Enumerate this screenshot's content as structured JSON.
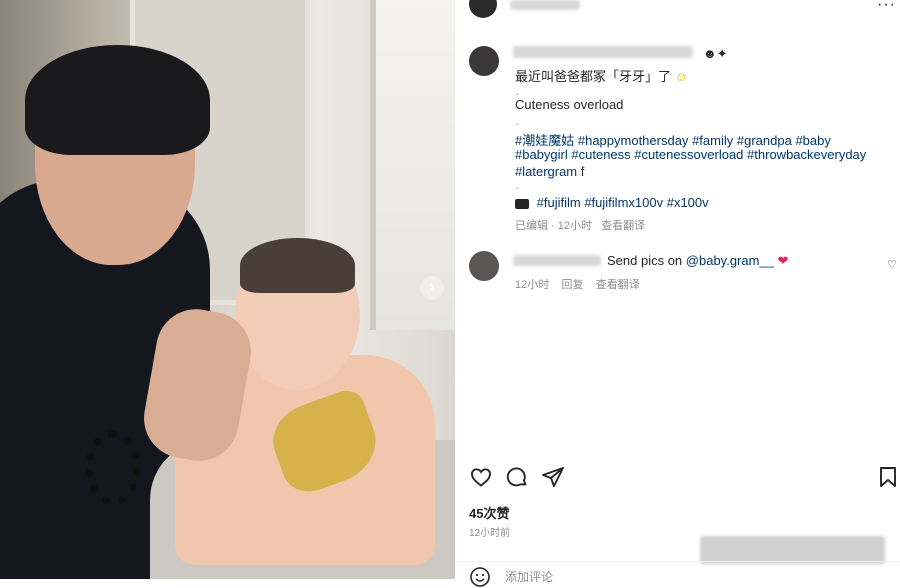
{
  "caption": {
    "line1": "最近叫爸爸都冢「牙牙」了",
    "line2": "Cuteness overload",
    "tags_row1": [
      "#潮娃魔姑",
      "#happymothersday",
      "#family",
      "#grandpa",
      "#baby"
    ],
    "tags_row2": [
      "#babygirl",
      "#cuteness",
      "#cutenessoverload",
      "#throwbackeveryday"
    ],
    "tags_row3": [
      "#latergram",
      "f"
    ],
    "camera_tags": [
      "#fujifilm",
      "#fujifilmx100v",
      "#x100v"
    ],
    "meta_time": "已编辑 · 12小时",
    "meta_translate": "查看翻译"
  },
  "comment": {
    "text": "Send pics on",
    "mention": "@baby.gram__",
    "time": "12小时",
    "reply": "回复",
    "translate": "查看翻译"
  },
  "post": {
    "likes": "45次赞",
    "time": "12小时前",
    "add_comment": "添加评论"
  },
  "icons": {
    "more": "more-icon",
    "like": "heart-icon",
    "comment": "comment-icon",
    "share": "share-icon",
    "save": "bookmark-icon",
    "next": "chevron-right-icon"
  }
}
